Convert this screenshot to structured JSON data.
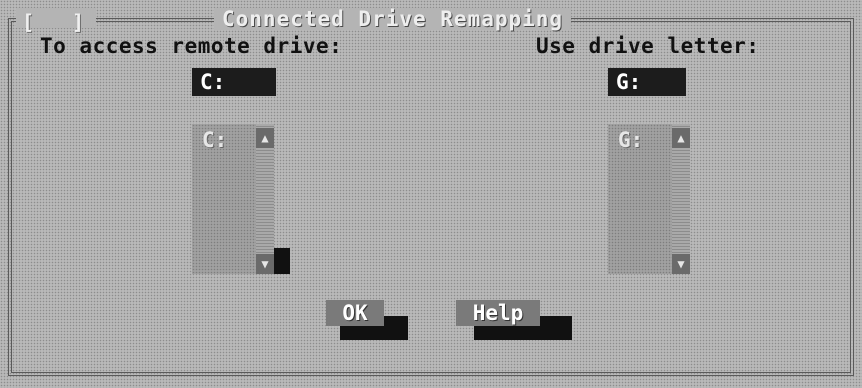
{
  "dialog": {
    "title": "Connected Drive Remapping",
    "system_menu": [
      "[",
      "]"
    ]
  },
  "remote": {
    "label": "To access remote drive:",
    "field_value": "C:",
    "list": [
      "C:"
    ]
  },
  "local": {
    "label": "Use drive letter:",
    "field_value": "G:",
    "list": [
      "G:"
    ]
  },
  "buttons": {
    "ok": "OK",
    "help": "Help"
  },
  "icons": {
    "scroll_up": "arrow-up-icon",
    "scroll_down": "arrow-down-icon"
  }
}
